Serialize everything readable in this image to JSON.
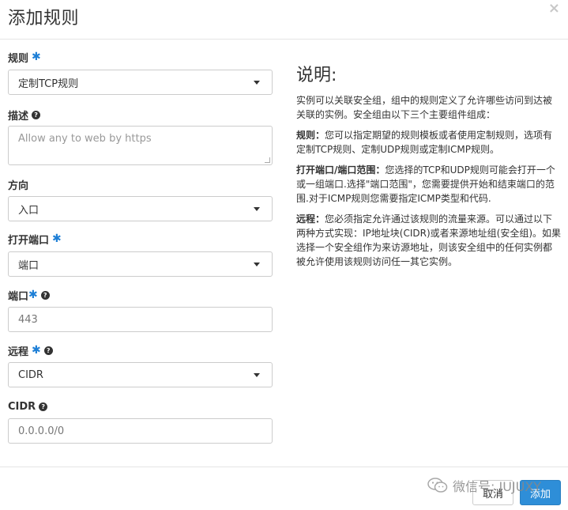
{
  "dialog": {
    "title": "添加规则",
    "close": "×"
  },
  "form": {
    "rule": {
      "label": "规则",
      "value": "定制TCP规则"
    },
    "description": {
      "label": "描述",
      "placeholder": "Allow any to web by https"
    },
    "direction": {
      "label": "方向",
      "value": "入口"
    },
    "open_port": {
      "label": "打开端口",
      "value": "端口"
    },
    "port": {
      "label": "端口",
      "value": "443"
    },
    "remote": {
      "label": "远程",
      "value": "CIDR"
    },
    "cidr": {
      "label": "CIDR",
      "value": "0.0.0.0/0"
    },
    "required_mark": "✱",
    "help_mark": "?"
  },
  "help": {
    "title": "说明:",
    "intro": "实例可以关联安全组，组中的规则定义了允许哪些访问到达被关联的实例。安全组由以下三个主要组件组成：",
    "rule_term": "规则：",
    "rule_text": "您可以指定期望的规则模板或者使用定制规则，选项有定制TCP规则、定制UDP规则或定制ICMP规则。",
    "port_term": "打开端口/端口范围：",
    "port_text": "您选择的TCP和UDP规则可能会打开一个或一组端口.选择\"端口范围\"，您需要提供开始和结束端口的范围.对于ICMP规则您需要指定ICMP类型和代码.",
    "remote_term": "远程：",
    "remote_text": "您必须指定允许通过该规则的流量来源。可以通过以下两种方式实现：IP地址块(CIDR)或者来源地址组(安全组)。如果选择一个安全组作为来访源地址，则该安全组中的任何实例都被允许使用该规则访问任一其它实例。"
  },
  "footer": {
    "cancel": "取消",
    "add": "添加"
  },
  "watermark": {
    "text": "微信号: JUJUXY"
  }
}
